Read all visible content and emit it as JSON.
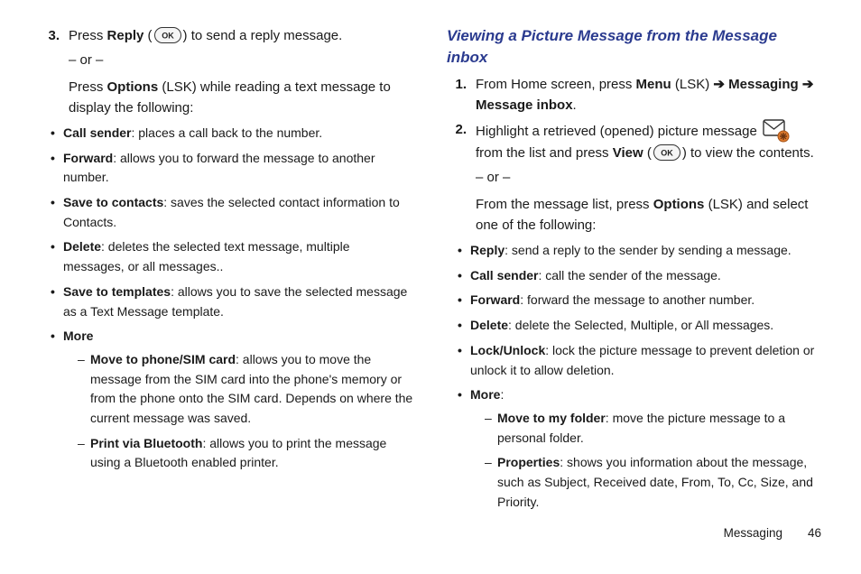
{
  "leftCol": {
    "step3_num": "3.",
    "step3_text_pre": "Press ",
    "step3_reply": "Reply",
    "step3_paren_open": " (",
    "step3_paren_close": ") to send a reply message.",
    "or": "– or –",
    "step3b_pre": "Press ",
    "step3b_options": "Options",
    "step3b_rest": " (LSK) while reading a text message to display the following:",
    "bullets": [
      {
        "bold": "Call sender",
        "rest": ": places a call back to the number."
      },
      {
        "bold": "Forward",
        "rest": ": allows you to forward the message to another number."
      },
      {
        "bold": "Save to contacts",
        "rest": ": saves the selected contact information to Contacts."
      },
      {
        "bold": "Delete",
        "rest": ": deletes the selected text message, multiple messages, or all messages.."
      },
      {
        "bold": "Save to templates",
        "rest": ": allows you to save the selected message as a Text Message template."
      },
      {
        "bold": "More",
        "rest": ""
      }
    ],
    "more_sub": [
      {
        "bold": "Move to phone/SIM card",
        "rest": ": allows you to move the message from the SIM card into the phone's memory or from the phone onto the SIM card. Depends on where the current message was saved."
      },
      {
        "bold": "Print via Bluetooth",
        "rest": ": allows you to print the message using a Bluetooth enabled printer."
      }
    ]
  },
  "rightCol": {
    "heading": "Viewing a Picture Message from the Message inbox",
    "step1_num": "1.",
    "step1": {
      "pre": "From Home screen, press ",
      "menu": "Menu",
      "lsk": " (LSK) ",
      "arrow1": "➔",
      "messaging": " Messaging ",
      "arrow2": "➔",
      "inbox": " Message inbox",
      "period": "."
    },
    "step2_num": "2.",
    "step2": {
      "line1_pre": "Highlight a retrieved (opened) picture message ",
      "line2_pre": "from the list and press ",
      "view": "View",
      "paren_open": " (",
      "paren_close": ") to view the contents."
    },
    "or": "– or –",
    "step2b_pre": "From the message list, press ",
    "step2b_options": "Options",
    "step2b_rest": " (LSK) and select one of the following:",
    "bullets": [
      {
        "bold": "Reply",
        "rest": ": send a reply to the sender by sending a message."
      },
      {
        "bold": "Call sender",
        "rest": ": call the sender of the message."
      },
      {
        "bold": "Forward",
        "rest": ": forward the message to another number."
      },
      {
        "bold": "Delete",
        "rest": ": delete the Selected, Multiple, or All messages."
      },
      {
        "bold": "Lock/Unlock",
        "rest": ": lock the picture message to prevent deletion or unlock it to allow deletion."
      },
      {
        "bold": "More",
        "rest": ":"
      }
    ],
    "more_sub": [
      {
        "bold": "Move to my folder",
        "rest": ": move the picture message to a personal folder."
      },
      {
        "bold": "Properties",
        "rest": ": shows you information about the message, such as Subject, Received date, From, To, Cc, Size, and Priority."
      }
    ]
  },
  "footer": {
    "section": "Messaging",
    "page": "46"
  }
}
